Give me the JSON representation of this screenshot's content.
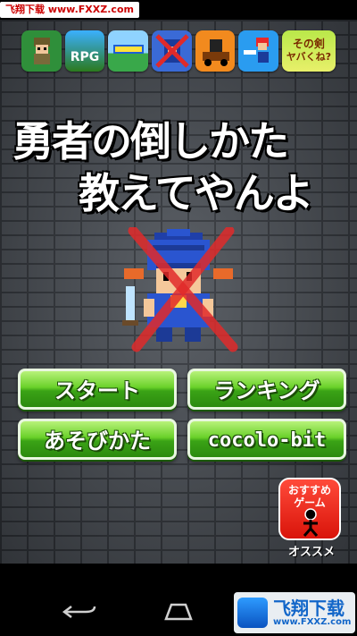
{
  "status_bar": {
    "watermark": "飞翔下载 www.FXXZ.com"
  },
  "ads": [
    {
      "icon": "pixel-soldier-icon",
      "text": ""
    },
    {
      "icon": "rpg-game-icon",
      "text": "RPG"
    },
    {
      "icon": "retro-logo-icon",
      "text": ""
    },
    {
      "icon": "crossed-hero-icon",
      "text": ""
    },
    {
      "icon": "cart-ride-icon",
      "text": ""
    },
    {
      "icon": "bird-hero-icon",
      "text": ""
    },
    {
      "icon": "sono-ken-icon",
      "text1": "その剣",
      "text2": "ヤバくね?"
    }
  ],
  "title": {
    "line1": "勇者の倒しかた",
    "line2": "教えてやんよ"
  },
  "buttons": {
    "start": "スタート",
    "ranking": "ランキング",
    "how_to_play": "あそびかた",
    "cocolo_bit": "cocolo-bit"
  },
  "recommend": {
    "icon_line1": "おすすめ",
    "icon_line2": "ゲーム",
    "label": "オススメ"
  },
  "nav_watermark": {
    "text": "飞翔下载",
    "url": "www.FXXZ.com"
  },
  "colors": {
    "button_green": "#4cc01e",
    "recommend_red": "#e8261a",
    "wall": "#4a4f56",
    "cross_red": "#e02a2a"
  }
}
